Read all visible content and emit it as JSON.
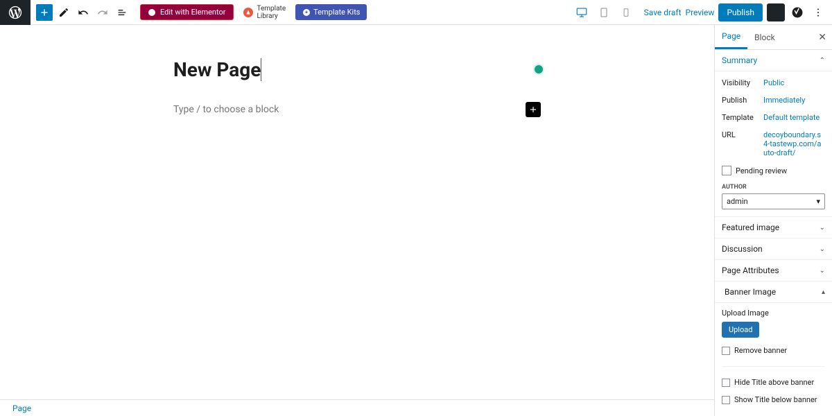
{
  "toolbar": {
    "edit_elementor": "Edit with Elementor",
    "template_library": "Template\nLibrary",
    "template_kits": "Template Kits",
    "save_draft": "Save draft",
    "preview": "Preview",
    "publish": "Publish"
  },
  "canvas": {
    "title": "New Page",
    "block_placeholder": "Type / to choose a block"
  },
  "sidebar": {
    "tabs": {
      "page": "Page",
      "block": "Block"
    },
    "summary": {
      "label": "Summary",
      "visibility_k": "Visibility",
      "visibility_v": "Public",
      "publish_k": "Publish",
      "publish_v": "Immediately",
      "template_k": "Template",
      "template_v": "Default template",
      "url_k": "URL",
      "url_v": "decoyboundary.s4-tastewp.com/auto-draft/",
      "pending_review": "Pending review",
      "author_label": "AUTHOR",
      "author_value": "admin"
    },
    "featured_image": "Featured image",
    "discussion": "Discussion",
    "page_attributes": "Page Attributes",
    "banner": {
      "label": "Banner Image",
      "upload_image": "Upload Image",
      "upload_btn": "Upload",
      "remove_banner": "Remove banner",
      "hide_title_above": "Hide Title above banner",
      "show_title_below": "Show Title below banner"
    }
  },
  "bottom": {
    "breadcrumb": "Page"
  }
}
